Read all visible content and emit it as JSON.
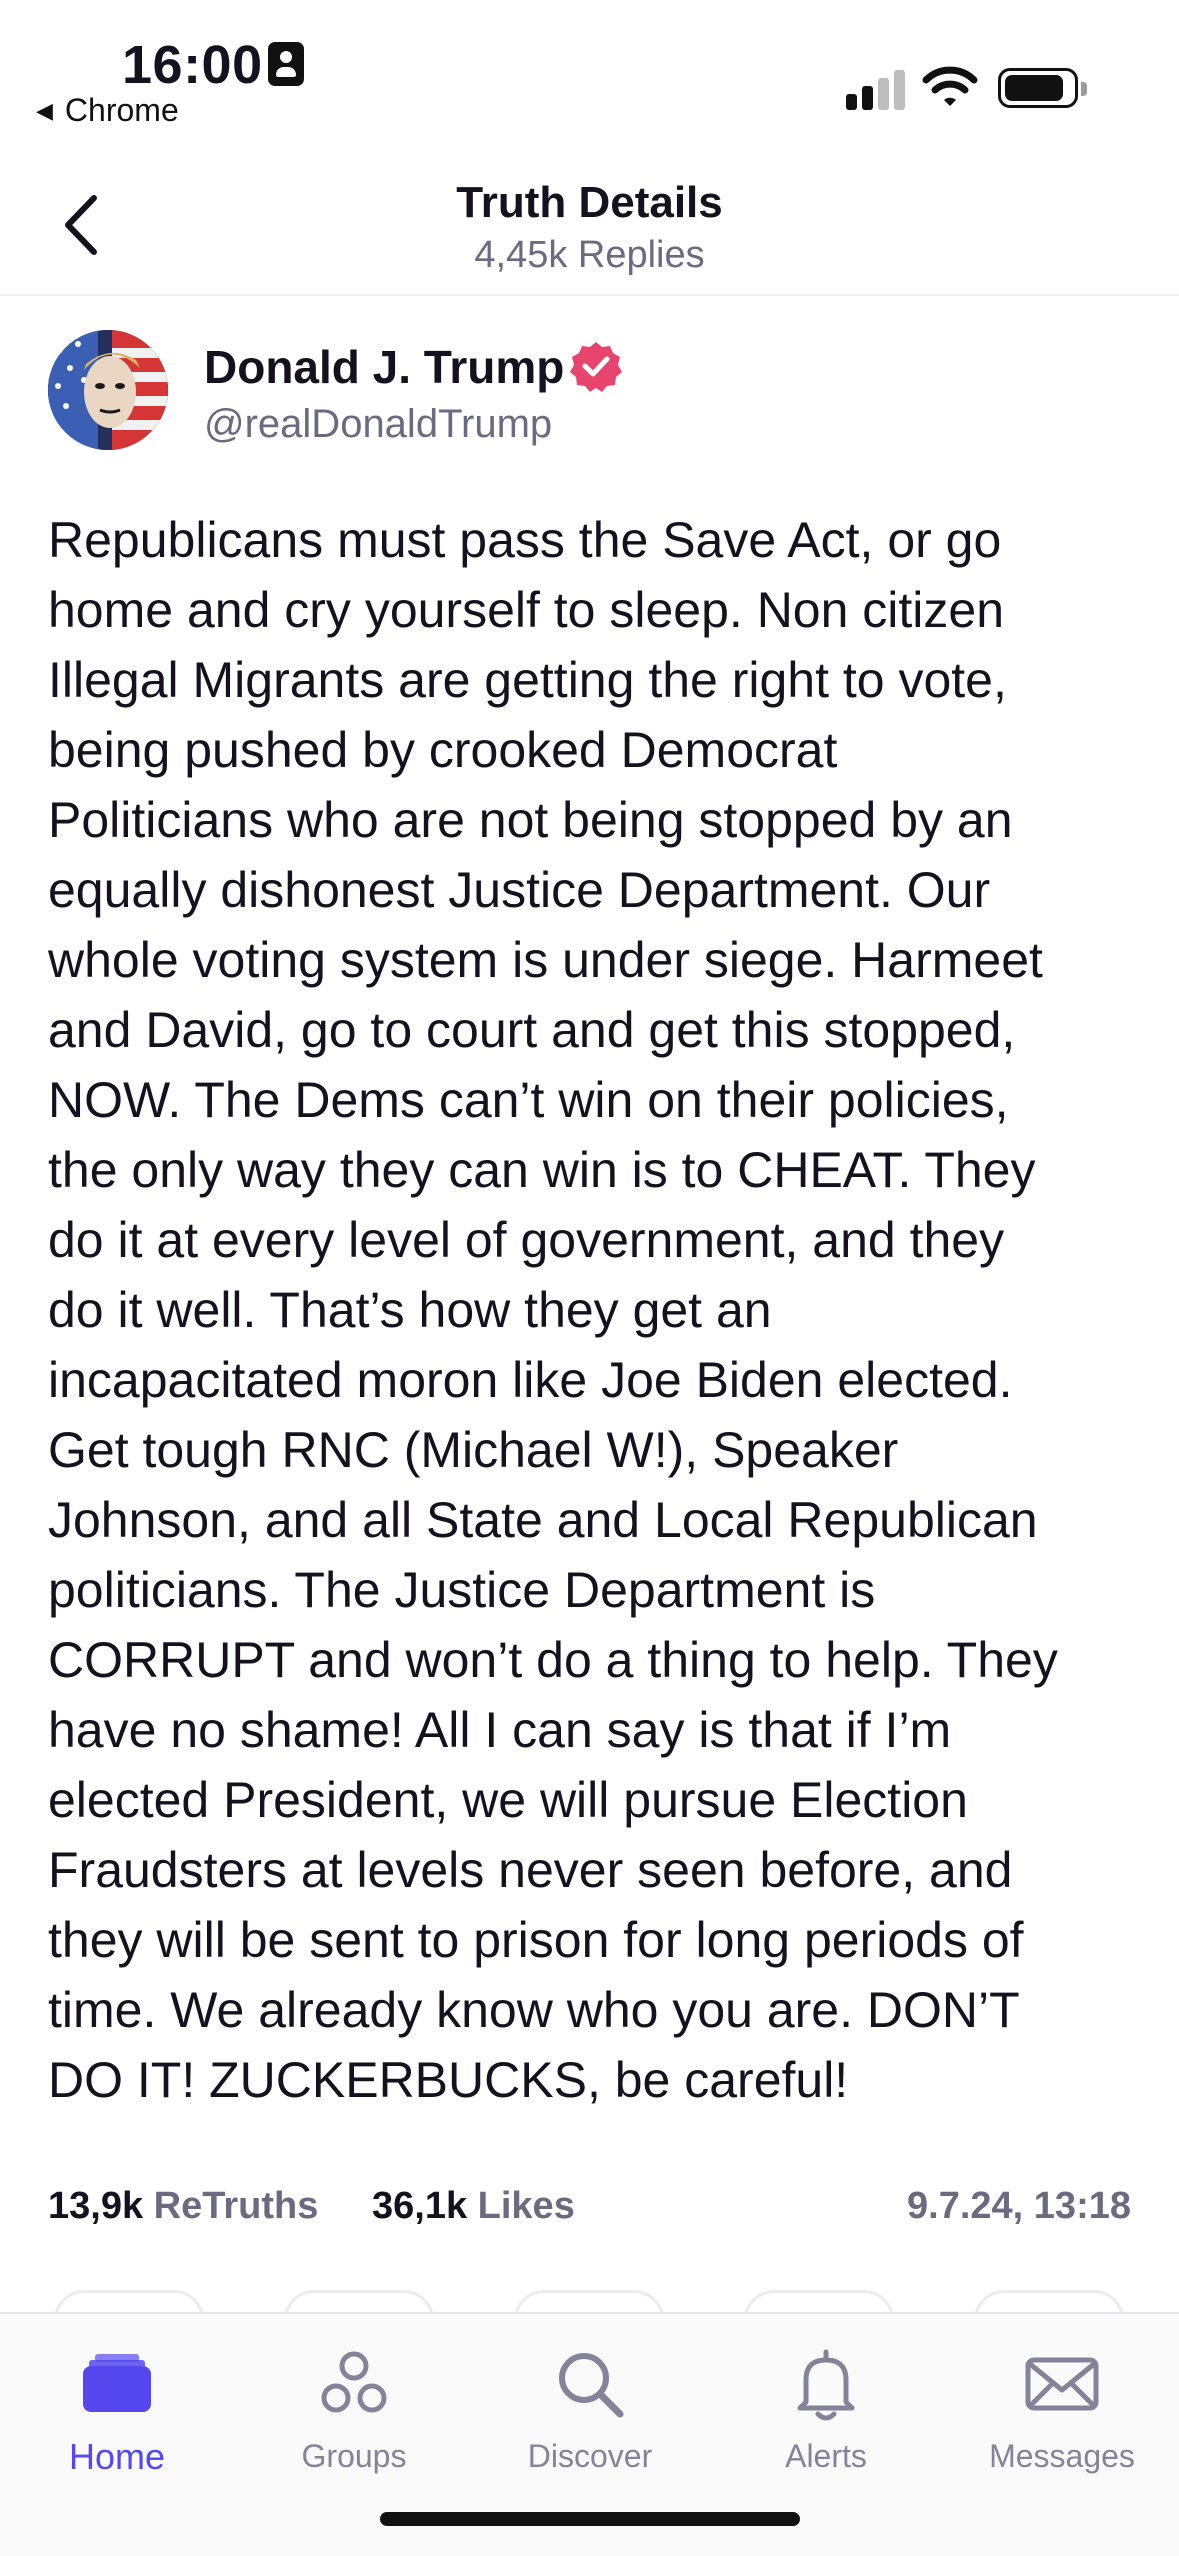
{
  "status_bar": {
    "time": "16:00",
    "back_app": "Chrome",
    "signal_icon": "cellular-signal-icon",
    "wifi_icon": "wifi-icon",
    "battery_icon": "battery-icon",
    "battery_level": 0.8
  },
  "header": {
    "title": "Truth Details",
    "subtitle": "4,45k Replies",
    "back_icon": "chevron-left-icon"
  },
  "post": {
    "author_name": "Donald J. Trump",
    "author_handle": "@realDonaldTrump",
    "verified_icon": "verified-badge-icon",
    "text": "Republicans must pass the Save Act, or go\nhome and cry yourself to sleep. Non citizen\nIllegal Migrants are getting the right to vote,\nbeing pushed by crooked Democrat\nPoliticians who are not being stopped by an\nequally dishonest Justice Department. Our\nwhole voting system is under siege. Harmeet\nand David, go to court and get this stopped,\nNOW. The Dems can’t win on their policies,\nthe only way they can win is to CHEAT. They\ndo it at every level of government, and they\ndo it well. That’s how they get an\nincapacitated moron like Joe Biden elected.\nGet tough RNC (Michael W!), Speaker\nJohnson, and all State and Local Republican\npoliticians. The Justice Department is\nCORRUPT and won’t do a thing to help. They\nhave no shame! All I can say is that if I’m\nelected President, we will pursue Election\nFraudsters at levels never seen before, and\nthey will be sent to prison for long periods of\ntime. We already know who you are. DON’T\nDO IT! ZUCKERBUCKS, be careful!",
    "retruths_count": "13,9k",
    "retruths_label": "ReTruths",
    "likes_count": "36,1k",
    "likes_label": "Likes",
    "timestamp": "9.7.24, 13:18"
  },
  "tabbar": {
    "accent_color": "#5448ee",
    "inactive_color": "#85839a",
    "tabs": [
      {
        "label": "Home",
        "icon": "home-stack-icon",
        "active": true
      },
      {
        "label": "Groups",
        "icon": "groups-icon",
        "active": false
      },
      {
        "label": "Discover",
        "icon": "search-icon",
        "active": false
      },
      {
        "label": "Alerts",
        "icon": "bell-icon",
        "active": false
      },
      {
        "label": "Messages",
        "icon": "envelope-icon",
        "active": false
      }
    ]
  }
}
